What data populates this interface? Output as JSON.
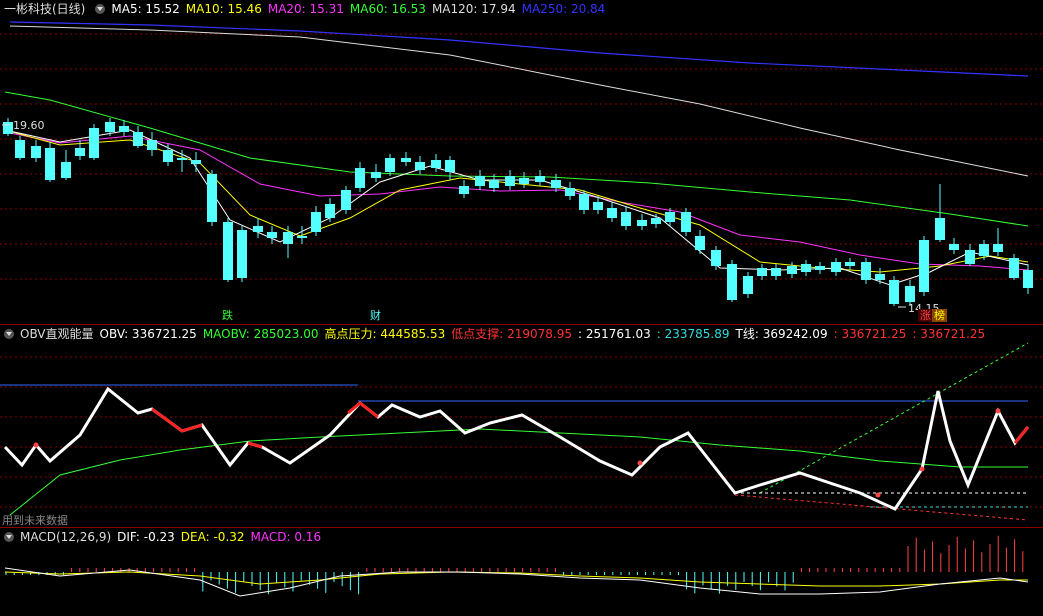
{
  "main": {
    "title": "一彬科技(日线)",
    "ma": [
      {
        "label": "MA5: 15.52",
        "color": "#ffffff"
      },
      {
        "label": "MA10: 15.46",
        "color": "#ffff00"
      },
      {
        "label": "MA20: 15.31",
        "color": "#ff33ff"
      },
      {
        "label": "MA60: 16.53",
        "color": "#33ff33"
      },
      {
        "label": "MA120: 17.94",
        "color": "#dddddd"
      },
      {
        "label": "MA250: 20.84",
        "color": "#3333ff"
      }
    ],
    "high_label": "19.60",
    "low_label": "14.15",
    "tags": {
      "die": "跌",
      "cai": "财",
      "zhang": "涨",
      "bang": "榜"
    }
  },
  "obv": {
    "title": "OBV直观能量",
    "items": [
      {
        "label": "OBV: 336721.25",
        "color": "#ffffff"
      },
      {
        "label": "MAOBV: 285023.00",
        "color": "#33ff33"
      },
      {
        "label": "高点压力: 444585.53",
        "color": "#ffff00"
      },
      {
        "label": "低点支撑: 219078.95",
        "color": "#ff3333"
      },
      {
        "label": ": 251761.03",
        "color": "#ffffff"
      },
      {
        "label": ": 233785.89",
        "color": "#33dddd"
      },
      {
        "label": "T线: 369242.09",
        "color": "#ffffff"
      },
      {
        "label": ": 336721.25",
        "color": "#ff3333"
      },
      {
        "label": ": 336721.25",
        "color": "#ff3333"
      }
    ],
    "future_note": "用到未来数据"
  },
  "macd": {
    "title": "MACD(12,26,9)",
    "items": [
      {
        "label": "DIF: -0.23",
        "color": "#ffffff"
      },
      {
        "label": "DEA: -0.32",
        "color": "#ffff00"
      },
      {
        "label": "MACD: 0.16",
        "color": "#ff33ff"
      }
    ]
  },
  "colors": {
    "up": "#ff4444",
    "down": "#54ffff",
    "grid": "#8b0000"
  }
}
